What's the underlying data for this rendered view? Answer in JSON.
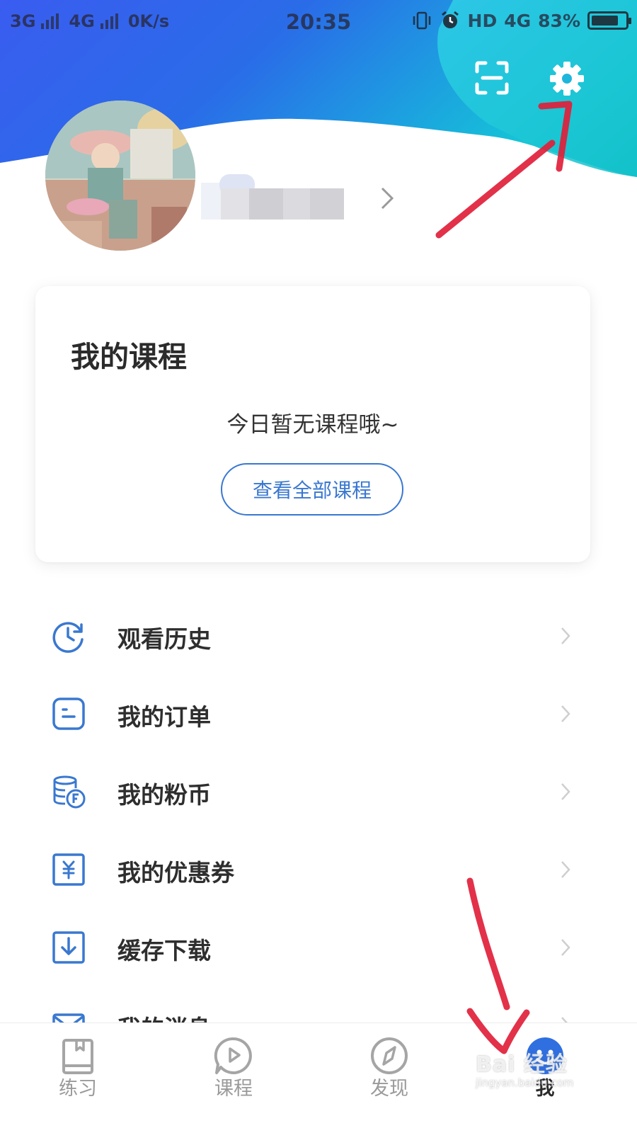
{
  "status_bar": {
    "left_text": "3G",
    "network_2": "4G",
    "speed": "0K/s",
    "time": "20:35",
    "hd": "HD",
    "network_3": "4G",
    "battery": "83%"
  },
  "profile": {
    "chevron_icon": "chevron-right-icon"
  },
  "header_actions": {
    "scan_icon": "scan-icon",
    "settings_icon": "gear-icon"
  },
  "course_card": {
    "title": "我的课程",
    "empty_text": "今日暂无课程哦~",
    "view_all_button": "查看全部课程"
  },
  "menu": [
    {
      "label": "观看历史",
      "icon": "history-clock-icon"
    },
    {
      "label": "我的订单",
      "icon": "order-icon"
    },
    {
      "label": "我的粉币",
      "icon": "coin-stack-icon"
    },
    {
      "label": "我的优惠券",
      "icon": "coupon-icon"
    },
    {
      "label": "缓存下载",
      "icon": "download-icon"
    },
    {
      "label": "我的消息",
      "icon": "message-icon"
    }
  ],
  "bottom_nav": [
    {
      "label": "练习",
      "icon": "book-icon",
      "active": false
    },
    {
      "label": "课程",
      "icon": "play-bubble-icon",
      "active": false
    },
    {
      "label": "发现",
      "icon": "compass-icon",
      "active": false
    },
    {
      "label": "我",
      "icon": "me-face-icon",
      "active": true
    }
  ],
  "watermark": {
    "main": "Bai 经验",
    "sub": "jingyan.baidu.com"
  },
  "colors": {
    "accent": "#3a78d0",
    "header_gradient_start": "#2f5fe8",
    "header_gradient_end": "#16c7d8",
    "annotation": "#e0203a"
  }
}
